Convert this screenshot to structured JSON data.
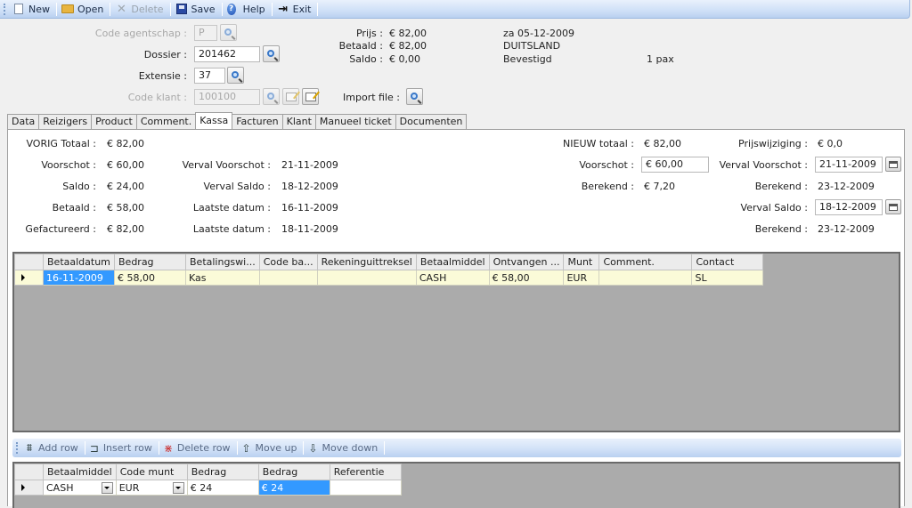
{
  "toolbar": {
    "new": "New",
    "open": "Open",
    "delete": "Delete",
    "save": "Save",
    "help": "Help",
    "exit": "Exit"
  },
  "header": {
    "code_agentschap_label": "Code agentschap :",
    "code_agentschap_value": "P",
    "dossier_label": "Dossier :",
    "dossier_value": "201462",
    "extensie_label": "Extensie :",
    "extensie_value": "37",
    "code_klant_label": "Code klant :",
    "code_klant_value": "100100",
    "import_file_label": "Import file :",
    "prijs_label": "Prijs :",
    "prijs_value": "€ 82,00",
    "betaald_label": "Betaald :",
    "betaald_value": "€ 82,00",
    "saldo_label": "Saldo :",
    "saldo_value": "€ 0,00",
    "date": "za 05-12-2009",
    "country": "DUITSLAND",
    "status": "Bevestigd",
    "pax": "1 pax"
  },
  "tabs": [
    "Data",
    "Reizigers",
    "Product",
    "Comment.",
    "Kassa",
    "Facturen",
    "Klant",
    "Manueel ticket",
    "Documenten"
  ],
  "active_tab": "Kassa",
  "kassa": {
    "vorig_totaal_label": "VORIG Totaal :",
    "vorig_totaal": "€ 82,00",
    "voorschot_label": "Voorschot :",
    "voorschot": "€ 60,00",
    "saldo_label": "Saldo :",
    "saldo": "€ 24,00",
    "betaald_label": "Betaald :",
    "betaald": "€ 58,00",
    "gefactureerd_label": "Gefactureerd :",
    "gefactureerd": "€ 82,00",
    "verval_voorschot_label": "Verval Voorschot :",
    "verval_voorschot": "21-11-2009",
    "verval_saldo_label": "Verval Saldo :",
    "verval_saldo": "18-12-2009",
    "laatste_datum_label": "Laatste datum :",
    "laatste_datum_1": "16-11-2009",
    "laatste_datum_2": "18-11-2009",
    "nieuw_totaal_label": "NIEUW totaal :",
    "nieuw_totaal": "€ 82,00",
    "nieuw_voorschot_label": "Voorschot :",
    "nieuw_voorschot": "€ 60,00",
    "berekend_label": "Berekend :",
    "berekend": "€ 7,20",
    "prijswijziging_label": "Prijswijziging :",
    "prijswijziging": "€ 0,0",
    "nieuw_verval_voorschot_label": "Verval Voorschot :",
    "nieuw_verval_voorschot": "21-11-2009",
    "berekend_voorschot_label": "Berekend :",
    "berekend_voorschot": "23-12-2009",
    "nieuw_verval_saldo_label": "Verval Saldo :",
    "nieuw_verval_saldo": "18-12-2009",
    "berekend_saldo_label": "Berekend :",
    "berekend_saldo": "23-12-2009"
  },
  "payments_grid": {
    "columns": [
      "Betaaldatum",
      "Bedrag",
      "Betalingswi...",
      "Code ba...",
      "Rekeninguittreksel",
      "Betaalmiddel",
      "Ontvangen ...",
      "Munt",
      "Comment.",
      "Contact"
    ],
    "rows": [
      [
        "16-11-2009",
        "€ 58,00",
        "Kas",
        "",
        "",
        "CASH",
        "€ 58,00",
        "EUR",
        "",
        "SL"
      ]
    ]
  },
  "row_toolbar": {
    "add_row": "Add row",
    "insert_row": "Insert row",
    "delete_row": "Delete row",
    "move_up": "Move up",
    "move_down": "Move down"
  },
  "entry_grid": {
    "columns": [
      "Betaalmiddel",
      "Code munt",
      "Bedrag",
      "Bedrag",
      "Referentie"
    ],
    "rows": [
      [
        "CASH",
        "EUR",
        "€ 24",
        "€ 24",
        ""
      ]
    ]
  }
}
